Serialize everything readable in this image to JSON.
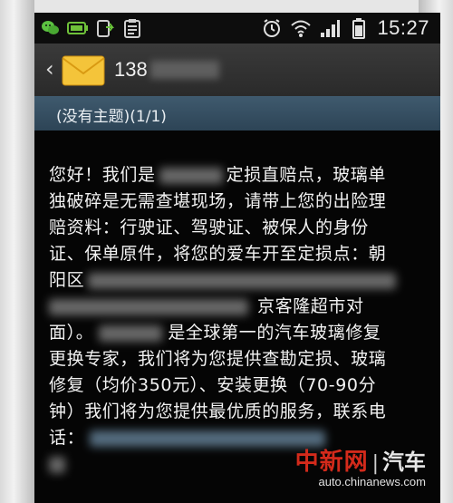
{
  "status_bar": {
    "time": "15:27",
    "icons_left": [
      "wechat-icon",
      "battery-saver-icon",
      "update-icon",
      "clipboard-icon"
    ],
    "icons_right": [
      "alarm-icon",
      "wifi-icon",
      "signal-icon",
      "battery-icon"
    ]
  },
  "conversation": {
    "sender_visible": "138",
    "avatar": "envelope-icon"
  },
  "subject": "(没有主题)(1/1)",
  "message": {
    "l1_a": "您好！我们是",
    "l1_b": "定损直赔点，玻璃单",
    "l2": "独破碎是无需查堪现场，请带上您的出险理",
    "l3": "赔资料：行驶证、驾驶证、被保人的身份",
    "l4": "证、保单原件，将您的爱车开至定损点：朝",
    "l5": "阳区",
    "l6": "京客隆超市对",
    "l7_a": "面）。",
    "l7_b": "是全球第一的汽车玻璃修复",
    "l8": "更换专家，我们将为您提供查勘定损、玻璃",
    "l9": "修复（均价350元）、安装更换（70-90分",
    "l10": "钟）我们将为您提供最优质的服务，联系电",
    "l11": "话："
  },
  "watermark": {
    "brand": "中新网",
    "separator": "|",
    "section": "汽车",
    "url": "auto.chinanews.com"
  },
  "colors": {
    "subject_bar": "#3a5466",
    "watermark_red": "#d32a1b"
  }
}
